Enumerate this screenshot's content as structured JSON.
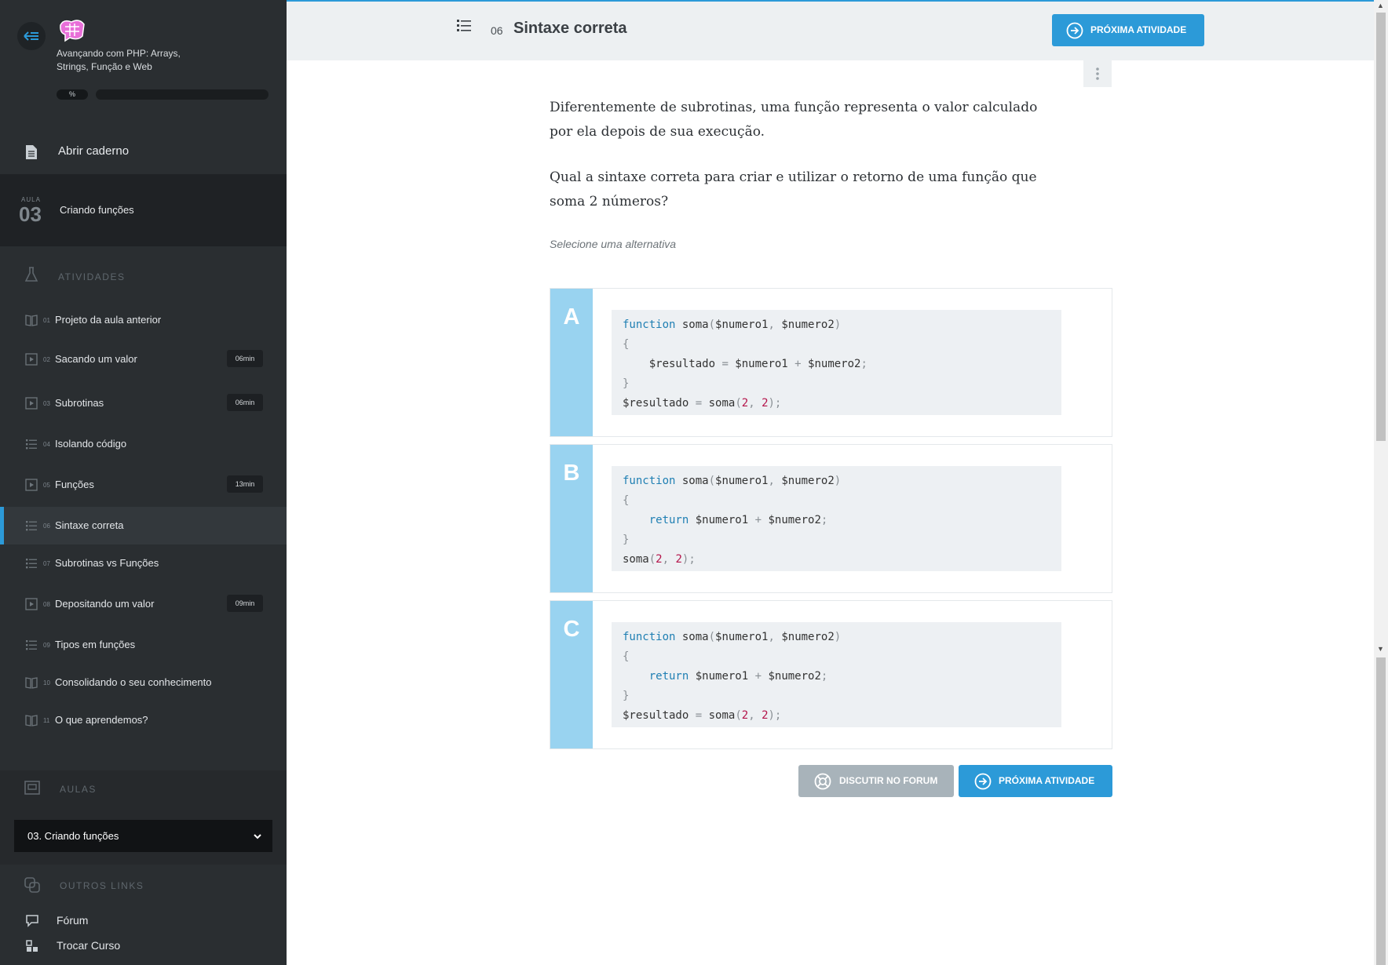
{
  "sidebar": {
    "course_name": "Avançando com PHP: Arrays, Strings, Função e Web",
    "progress_label": "%",
    "progress_value": 0,
    "notebook_label": "Abrir caderno",
    "lesson": {
      "aula_label": "AULA",
      "number": "03",
      "title": "Criando funções"
    },
    "activities_heading": "ATIVIDADES",
    "activities": [
      {
        "num": "01",
        "title": "Projeto da aula anterior",
        "icon": "book-icon",
        "duration": ""
      },
      {
        "num": "02",
        "title": "Sacando um valor",
        "icon": "video-icon",
        "duration": "06min"
      },
      {
        "num": "03",
        "title": "Subrotinas",
        "icon": "video-icon",
        "duration": "06min"
      },
      {
        "num": "04",
        "title": "Isolando código",
        "icon": "list-icon",
        "duration": ""
      },
      {
        "num": "05",
        "title": "Funções",
        "icon": "video-icon",
        "duration": "13min"
      },
      {
        "num": "06",
        "title": "Sintaxe correta",
        "icon": "list-icon",
        "duration": "",
        "active": true
      },
      {
        "num": "07",
        "title": "Subrotinas vs Funções",
        "icon": "list-icon",
        "duration": ""
      },
      {
        "num": "08",
        "title": "Depositando um valor",
        "icon": "video-icon",
        "duration": "09min"
      },
      {
        "num": "09",
        "title": "Tipos em funções",
        "icon": "list-icon",
        "duration": ""
      },
      {
        "num": "10",
        "title": "Consolidando o seu conhecimento",
        "icon": "book-icon",
        "duration": ""
      },
      {
        "num": "11",
        "title": "O que aprendemos?",
        "icon": "book-icon",
        "duration": ""
      }
    ],
    "aulas_heading": "AULAS",
    "aulas_selected": "03. Criando funções",
    "other_links_heading": "OUTROS LINKS",
    "links": [
      {
        "label": "Fórum",
        "icon": "chat-icon"
      },
      {
        "label": "Trocar Curso",
        "icon": "switch-icon"
      }
    ]
  },
  "header": {
    "activity_num": "06",
    "activity_title": "Sintaxe correta",
    "next_label": "PRÓXIMA ATIVIDADE"
  },
  "content": {
    "paragraph1": "Diferentemente de subrotinas, uma função representa o valor calculado por ela depois de sua execução.",
    "paragraph2": "Qual a sintaxe correta para criar e utilizar o retorno de uma função que soma 2 números?",
    "hint": "Selecione uma alternativa",
    "alternatives": [
      {
        "letter": "A"
      },
      {
        "letter": "B"
      },
      {
        "letter": "C"
      }
    ],
    "forum_button": "DISCUTIR NO FORUM",
    "next_button": "PRÓXIMA ATIVIDADE"
  },
  "colors": {
    "accent": "#2c9ad8",
    "sidebar_bg": "#2a2e31",
    "letter_bg": "#99d3f0",
    "code_bg": "#edf0f3"
  }
}
